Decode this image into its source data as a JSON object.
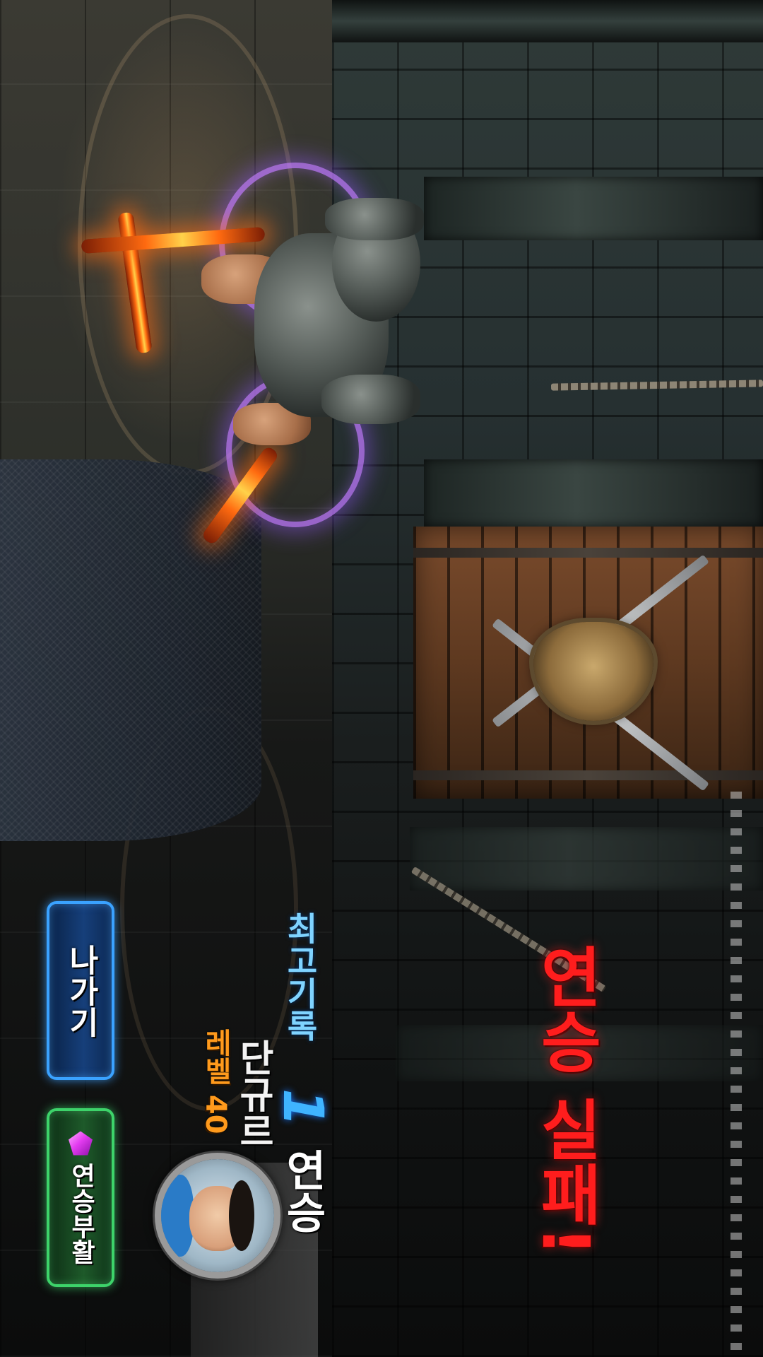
{
  "result": {
    "title": "연승 실패!"
  },
  "record": {
    "label": "최고기록",
    "count": "1",
    "unit": "연승"
  },
  "player": {
    "name": "단규르",
    "level": "레벨 40"
  },
  "buttons": {
    "exit": "나가기",
    "revive": "연승부활",
    "revive_icon": "gem-icon"
  },
  "colors": {
    "title": "#ff1d1d",
    "record_label": "#7fd3ff",
    "record_count": "#3fb4ff",
    "level": "#ff9a1c",
    "exit_border": "#3aa2ff",
    "revive_border": "#3dd36a"
  }
}
